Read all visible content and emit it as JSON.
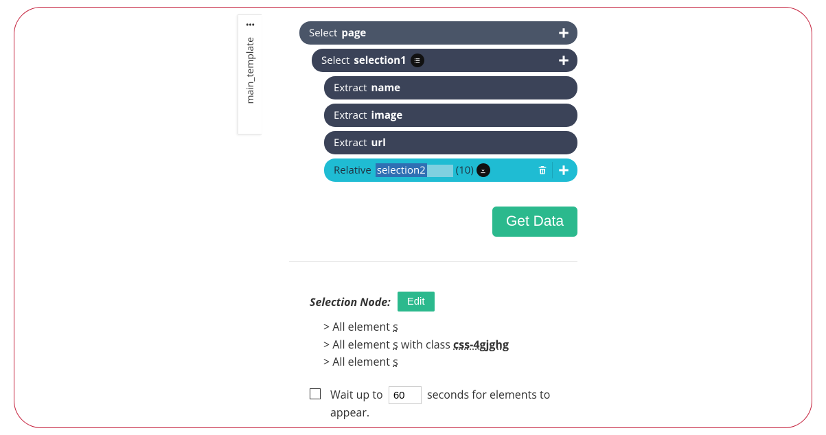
{
  "template_tab": {
    "label": "main_template"
  },
  "tree": {
    "page": {
      "kw": "Select",
      "name": "page"
    },
    "sel1": {
      "kw": "Select",
      "name": "selection1"
    },
    "ex_name": {
      "kw": "Extract",
      "name": "name"
    },
    "ex_img": {
      "kw": "Extract",
      "name": "image"
    },
    "ex_url": {
      "kw": "Extract",
      "name": "url"
    },
    "rel": {
      "kw": "Relative",
      "name": "selection2",
      "count": "(10)"
    }
  },
  "actions": {
    "get_data": "Get Data"
  },
  "detail": {
    "label": "Selection Node:",
    "edit": "Edit",
    "crumb1_a": "> All element ",
    "crumb1_b": "s",
    "crumb2_a": "> All element ",
    "crumb2_b": "s",
    "crumb2_c": " with class ",
    "crumb2_cls": "css-4gjghg",
    "crumb3_a": "> All element ",
    "crumb3_b": "s",
    "wait_a": "Wait up to ",
    "wait_val": "60",
    "wait_b": " seconds for elements to appear."
  }
}
